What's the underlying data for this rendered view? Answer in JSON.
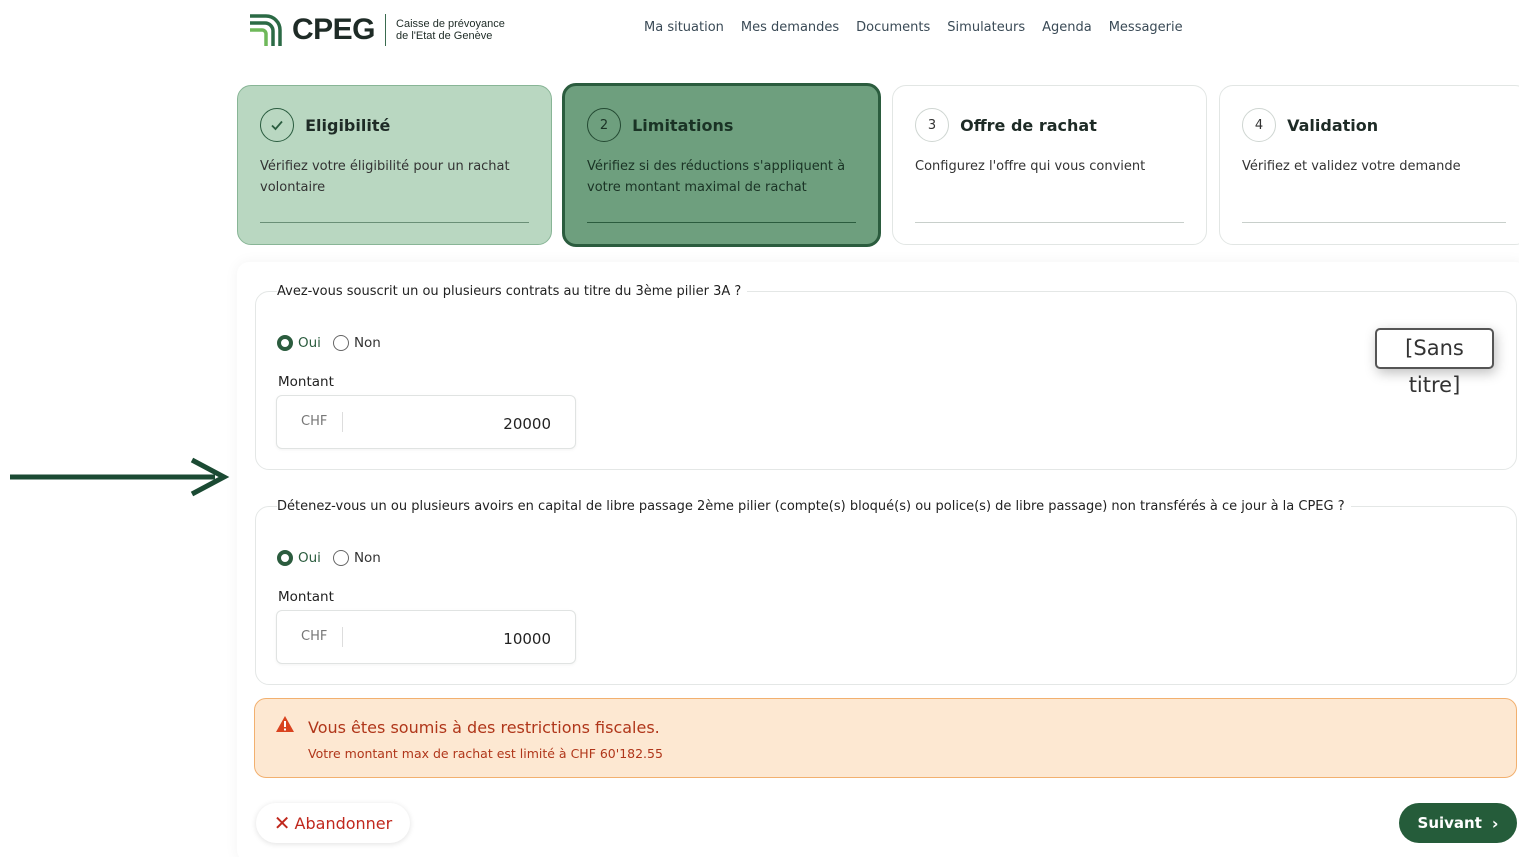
{
  "header": {
    "logo_text": "CPEG",
    "logo_sub_line1": "Caisse de prévoyance",
    "logo_sub_line2": "de l'Etat de Genève",
    "nav": [
      "Ma situation",
      "Mes demandes",
      "Documents",
      "Simulateurs",
      "Agenda",
      "Messagerie"
    ]
  },
  "steps": [
    {
      "marker": "✓",
      "title": "Eligibilité",
      "desc": "Vérifiez votre éligibilité pour un rachat volontaire",
      "state": "done"
    },
    {
      "marker": "2",
      "title": "Limitations",
      "desc": "Vérifiez si des réductions s'appliquent à votre montant maximal de rachat",
      "state": "active"
    },
    {
      "marker": "3",
      "title": "Offre de rachat",
      "desc": "Configurez l'offre qui vous convient",
      "state": "pending"
    },
    {
      "marker": "4",
      "title": "Validation",
      "desc": "Vérifiez et validez votre demande",
      "state": "pending"
    }
  ],
  "questions": [
    {
      "legend": "Avez-vous souscrit un ou plusieurs contrats au titre du 3ème pilier 3A ?",
      "options": [
        "Oui",
        "Non"
      ],
      "selected": "Oui",
      "amount_label": "Montant",
      "currency": "CHF",
      "amount": "20000"
    },
    {
      "legend": "Détenez-vous un ou plusieurs avoirs en capital de libre passage 2ème pilier (compte(s) bloqué(s) ou police(s) de libre passage) non transférés à ce jour à la CPEG ?",
      "options": [
        "Oui",
        "Non"
      ],
      "selected": "Oui",
      "amount_label": "Montant",
      "currency": "CHF",
      "amount": "10000"
    }
  ],
  "tooltip": "[Sans titre]",
  "warning": {
    "title": "Vous êtes soumis à des restrictions fiscales.",
    "text": "Votre montant max de rachat est limité à CHF 60'182.55"
  },
  "actions": {
    "cancel": "Abandonner",
    "next": "Suivant"
  },
  "colors": {
    "brand": "#255c3a",
    "warning_text": "#b0361a",
    "warning_bg": "#fde8d2"
  }
}
